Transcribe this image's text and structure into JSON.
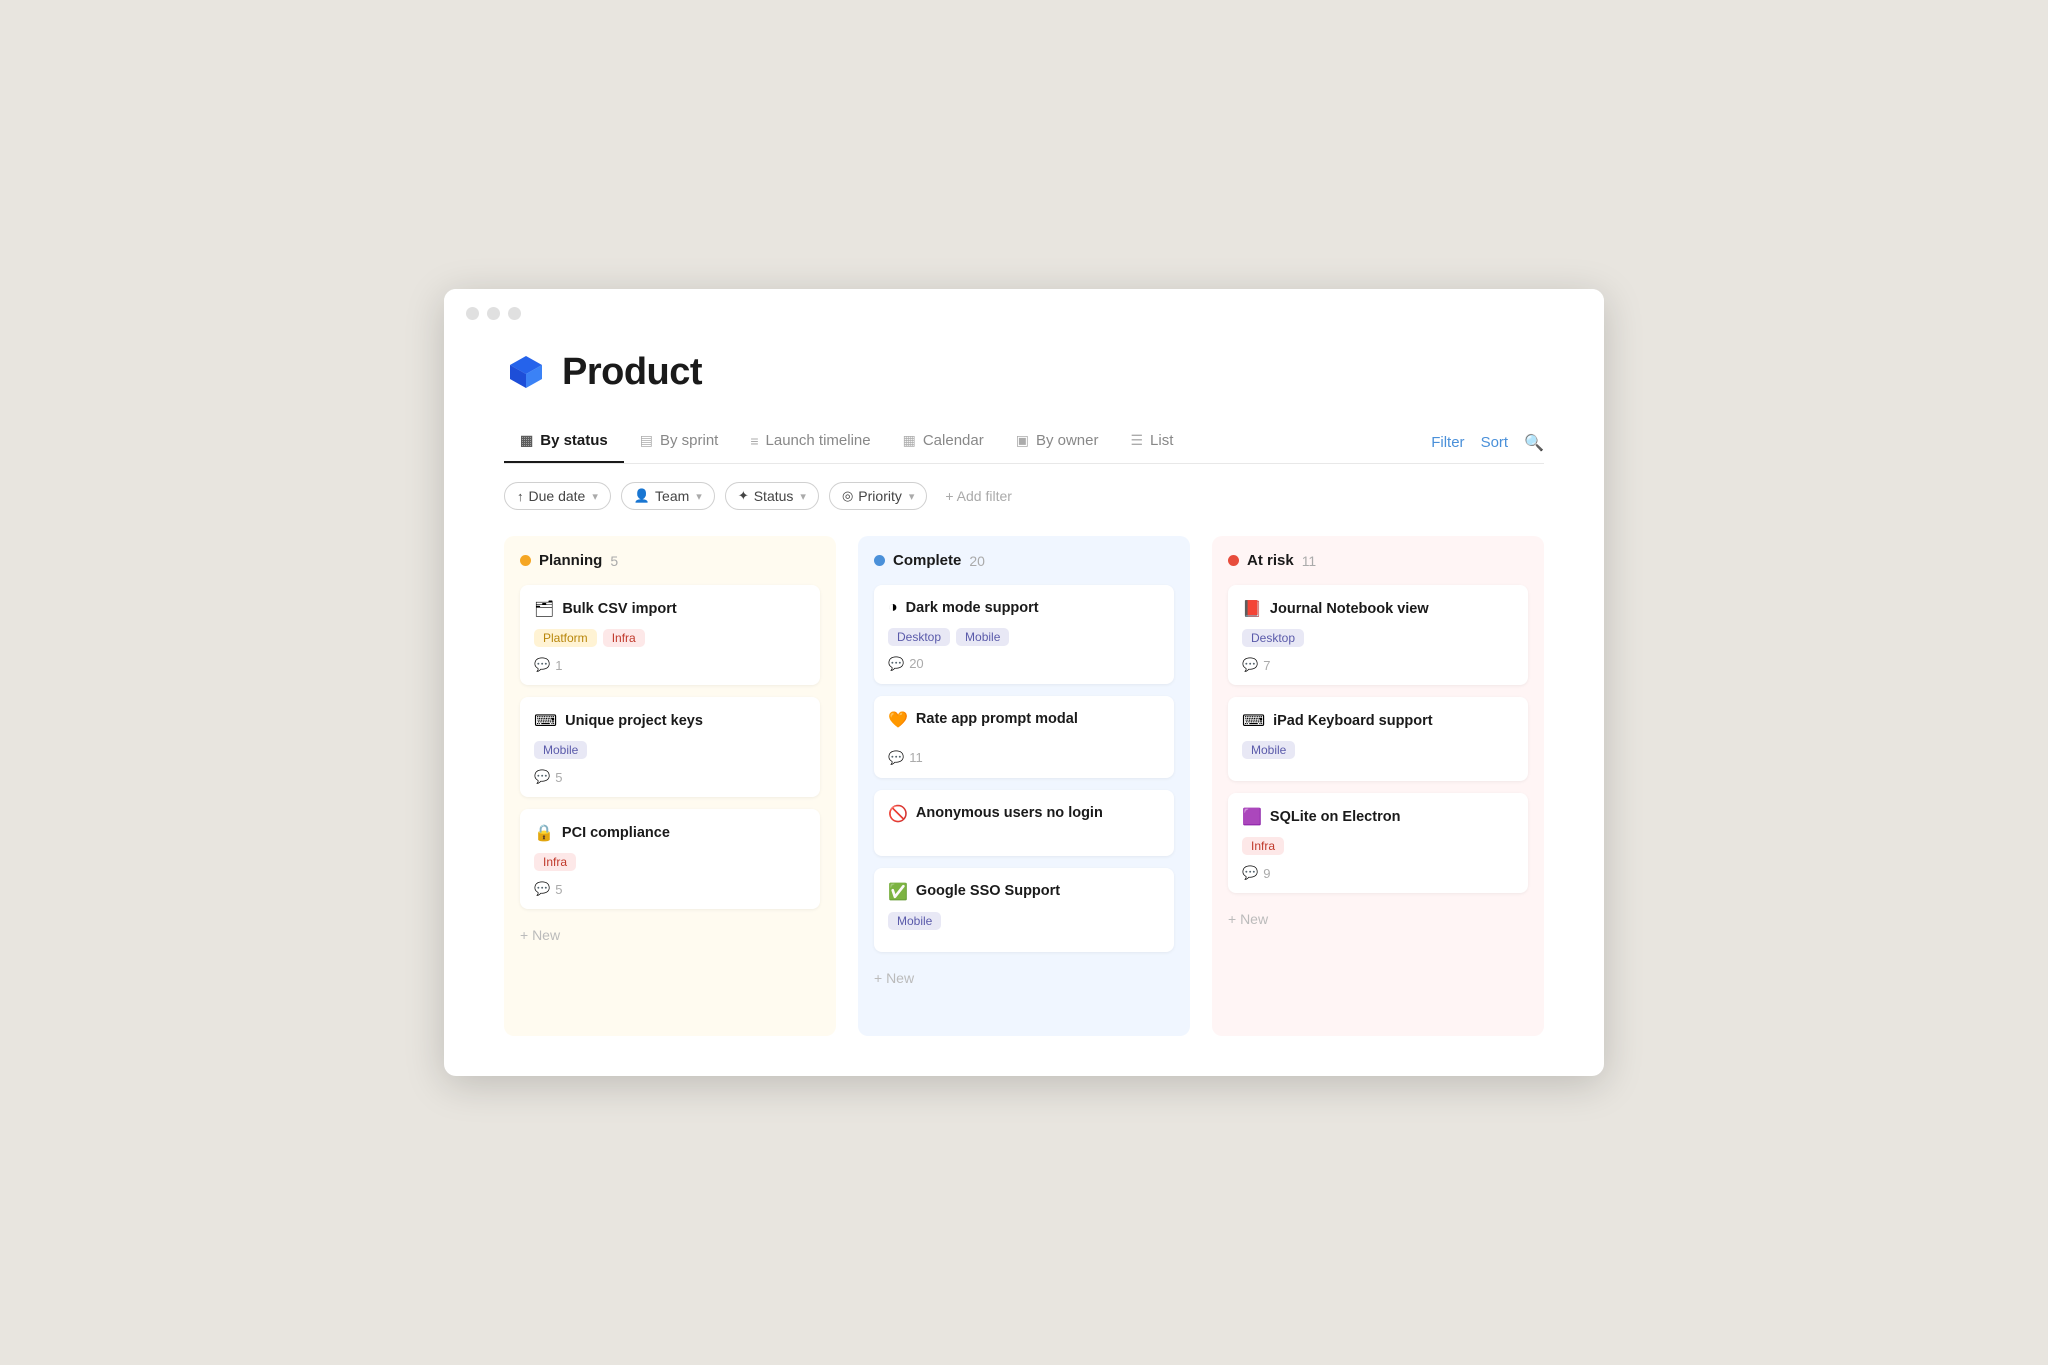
{
  "window": {
    "title": "Product"
  },
  "header": {
    "page_title": "Product",
    "page_icon": "📦"
  },
  "tabs": [
    {
      "id": "by-status",
      "label": "By status",
      "icon": "▦",
      "active": true
    },
    {
      "id": "by-sprint",
      "label": "By sprint",
      "icon": "▤",
      "active": false
    },
    {
      "id": "launch-timeline",
      "label": "Launch timeline",
      "icon": "≡",
      "active": false
    },
    {
      "id": "calendar",
      "label": "Calendar",
      "icon": "▦",
      "active": false
    },
    {
      "id": "by-owner",
      "label": "By owner",
      "icon": "▣",
      "active": false
    },
    {
      "id": "list",
      "label": "List",
      "icon": "☰",
      "active": false
    }
  ],
  "tab_actions": {
    "filter": "Filter",
    "sort": "Sort"
  },
  "filters": [
    {
      "id": "due-date",
      "icon": "↑",
      "label": "Due date",
      "has_chevron": true
    },
    {
      "id": "team",
      "icon": "👤",
      "label": "Team",
      "has_chevron": true
    },
    {
      "id": "status",
      "icon": "✦",
      "label": "Status",
      "has_chevron": true
    },
    {
      "id": "priority",
      "icon": "◎",
      "label": "Priority",
      "has_chevron": true
    }
  ],
  "add_filter_label": "+ Add filter",
  "columns": [
    {
      "id": "planning",
      "title": "Planning",
      "count": 5,
      "status_type": "planning",
      "cards": [
        {
          "id": "bulk-csv",
          "emoji": "🗂",
          "title": "Bulk CSV import",
          "tags": [
            {
              "label": "Platform",
              "type": "platform"
            },
            {
              "label": "Infra",
              "type": "infra"
            }
          ],
          "comments": 1
        },
        {
          "id": "unique-project-keys",
          "emoji": "⌨",
          "title": "Unique project keys",
          "tags": [
            {
              "label": "Mobile",
              "type": "mobile"
            }
          ],
          "comments": 5
        },
        {
          "id": "pci-compliance",
          "emoji": "🔒",
          "title": "PCI compliance",
          "tags": [
            {
              "label": "Infra",
              "type": "infra"
            }
          ],
          "comments": 5
        }
      ],
      "new_label": "+ New"
    },
    {
      "id": "complete",
      "title": "Complete",
      "count": 20,
      "status_type": "complete",
      "cards": [
        {
          "id": "dark-mode",
          "emoji": "◑",
          "title": "Dark mode support",
          "tags": [
            {
              "label": "Desktop",
              "type": "desktop"
            },
            {
              "label": "Mobile",
              "type": "mobile"
            }
          ],
          "comments": 20
        },
        {
          "id": "rate-app-prompt",
          "emoji": "🧡",
          "title": "Rate app prompt modal",
          "tags": [],
          "comments": 11
        },
        {
          "id": "anonymous-users",
          "emoji": "🚫",
          "title": "Anonymous users no login",
          "tags": [],
          "comments": null
        },
        {
          "id": "google-sso",
          "emoji": "✅",
          "title": "Google SSO Support",
          "tags": [
            {
              "label": "Mobile",
              "type": "mobile"
            }
          ],
          "comments": null
        }
      ],
      "new_label": "+ New"
    },
    {
      "id": "at-risk",
      "title": "At risk",
      "count": 11,
      "status_type": "at-risk",
      "cards": [
        {
          "id": "journal-notebook",
          "emoji": "📕",
          "title": "Journal Notebook view",
          "tags": [
            {
              "label": "Desktop",
              "type": "desktop"
            }
          ],
          "comments": 7
        },
        {
          "id": "ipad-keyboard",
          "emoji": "⌨",
          "title": "iPad Keyboard support",
          "tags": [
            {
              "label": "Mobile",
              "type": "mobile"
            }
          ],
          "comments": null
        },
        {
          "id": "sqlite-electron",
          "emoji": "🟪",
          "title": "SQLite on Electron",
          "tags": [
            {
              "label": "Infra",
              "type": "infra"
            }
          ],
          "comments": 9
        }
      ],
      "new_label": "+ New"
    }
  ]
}
